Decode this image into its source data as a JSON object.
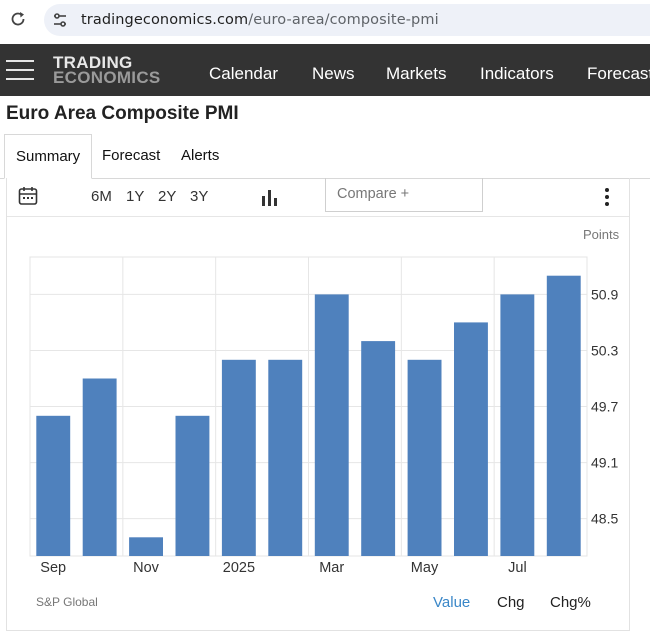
{
  "browser": {
    "url_domain": "tradingeconomics.com",
    "url_path": "/euro-area/composite-pmi"
  },
  "nav": {
    "logo_line1": "TRADING",
    "logo_line2": "ECONOMICS",
    "items": [
      "Calendar",
      "News",
      "Markets",
      "Indicators",
      "Forecast"
    ]
  },
  "page": {
    "title": "Euro Area Composite PMI"
  },
  "tabs": [
    "Summary",
    "Forecast",
    "Alerts"
  ],
  "toolbar": {
    "ranges": [
      "6M",
      "1Y",
      "2Y",
      "3Y"
    ],
    "compare_placeholder": "Compare +"
  },
  "footer": {
    "source": "S&P Global",
    "modes": [
      "Value",
      "Chg",
      "Chg%"
    ],
    "active_mode": "Value"
  },
  "colors": {
    "bar": "#4f81bd",
    "nav_bg": "#333333",
    "active_link": "#3a87c8"
  },
  "chart_data": {
    "type": "bar",
    "unit_label": "Points",
    "categories": [
      "Sep",
      "Oct",
      "Nov",
      "Dec",
      "2025",
      "Feb",
      "Mar",
      "Apr",
      "May",
      "Jun",
      "Jul",
      "Aug"
    ],
    "x_tick_labels": [
      "Sep",
      "Nov",
      "2025",
      "Mar",
      "May",
      "Jul"
    ],
    "values": [
      49.6,
      50.0,
      48.3,
      49.6,
      50.2,
      50.2,
      50.9,
      50.4,
      50.2,
      50.6,
      50.9,
      51.1
    ],
    "yticks": [
      48.5,
      49.1,
      49.7,
      50.3,
      50.9
    ],
    "ylim": [
      48.1,
      51.3
    ],
    "y_axis_side": "right",
    "grid": true
  }
}
